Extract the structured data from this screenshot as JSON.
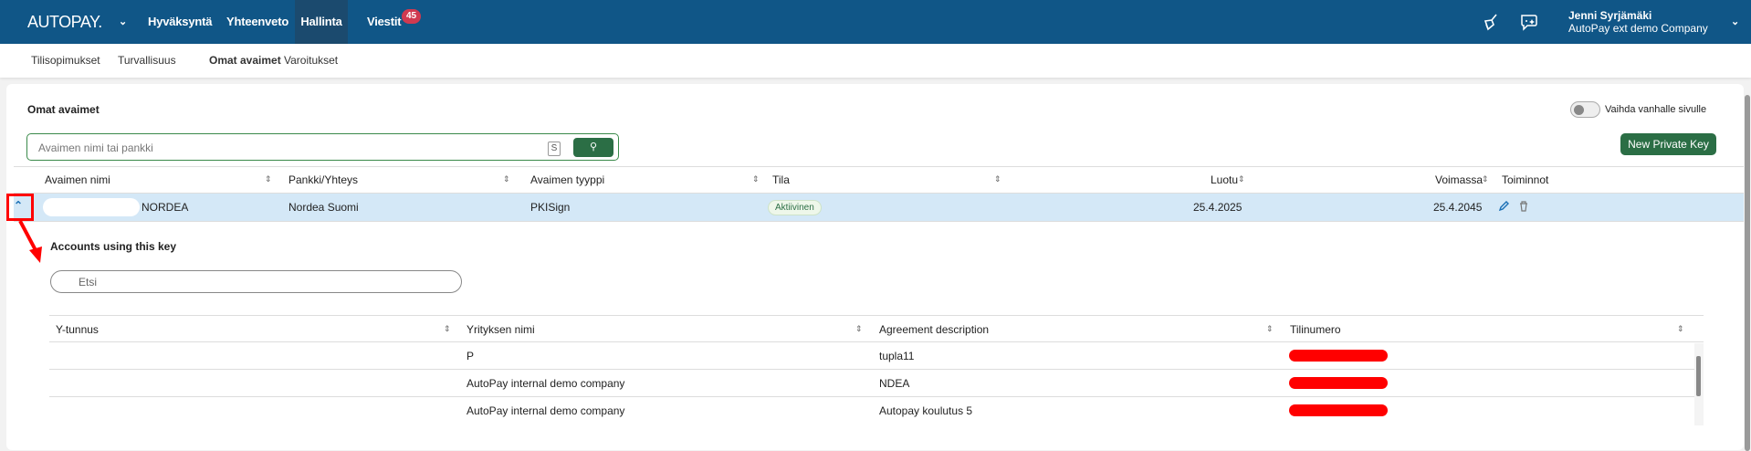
{
  "topnav": {
    "logo": "AUTOPAY.",
    "items": [
      "Hyväksyntä",
      "Yhteenveto",
      "Hallinta",
      "Viestit"
    ],
    "active": "Hallinta",
    "messages_badge": "45",
    "user_name": "Jenni Syrjämäki",
    "company": "AutoPay ext demo Company"
  },
  "subnav": {
    "items": [
      "Tilisopimukset",
      "Turvallisuus",
      "Omat avaimet",
      "Varoitukset"
    ],
    "active": "Omat avaimet"
  },
  "page": {
    "title": "Omat avaimet",
    "toggle_label": "Vaihda vanhalle sivulle",
    "search_placeholder": "Avaimen nimi tai pankki",
    "search_shortcut": "S",
    "new_key_label": "New Private Key"
  },
  "keys_table": {
    "columns": [
      "Avaimen nimi",
      "Pankki/Yhteys",
      "Avaimen tyyppi",
      "Tila",
      "Luotu",
      "Voimassa",
      "Toiminnot"
    ],
    "rows": [
      {
        "name": "NORDEA",
        "bank": "Nordea Suomi",
        "type": "PKISign",
        "status": "Aktiivinen",
        "created": "25.4.2025",
        "valid": "25.4.2045"
      }
    ]
  },
  "accounts": {
    "title": "Accounts using this key",
    "search_placeholder": "Etsi",
    "columns": [
      "Y-tunnus",
      "Yrityksen nimi",
      "Agreement description",
      "Tilinumero"
    ],
    "rows": [
      {
        "ytunnus": "",
        "company": "P",
        "description": "tupla11"
      },
      {
        "ytunnus": "",
        "company": "AutoPay internal demo company",
        "description": "NDEA"
      },
      {
        "ytunnus": "",
        "company": "AutoPay internal demo company",
        "description": "Autopay koulutus 5"
      }
    ]
  },
  "colors": {
    "nav": "#105687",
    "active_nav": "#1b4a6e",
    "green": "#2b6e45",
    "selected_row": "#d4e8f7",
    "annotation": "#ff0000"
  }
}
